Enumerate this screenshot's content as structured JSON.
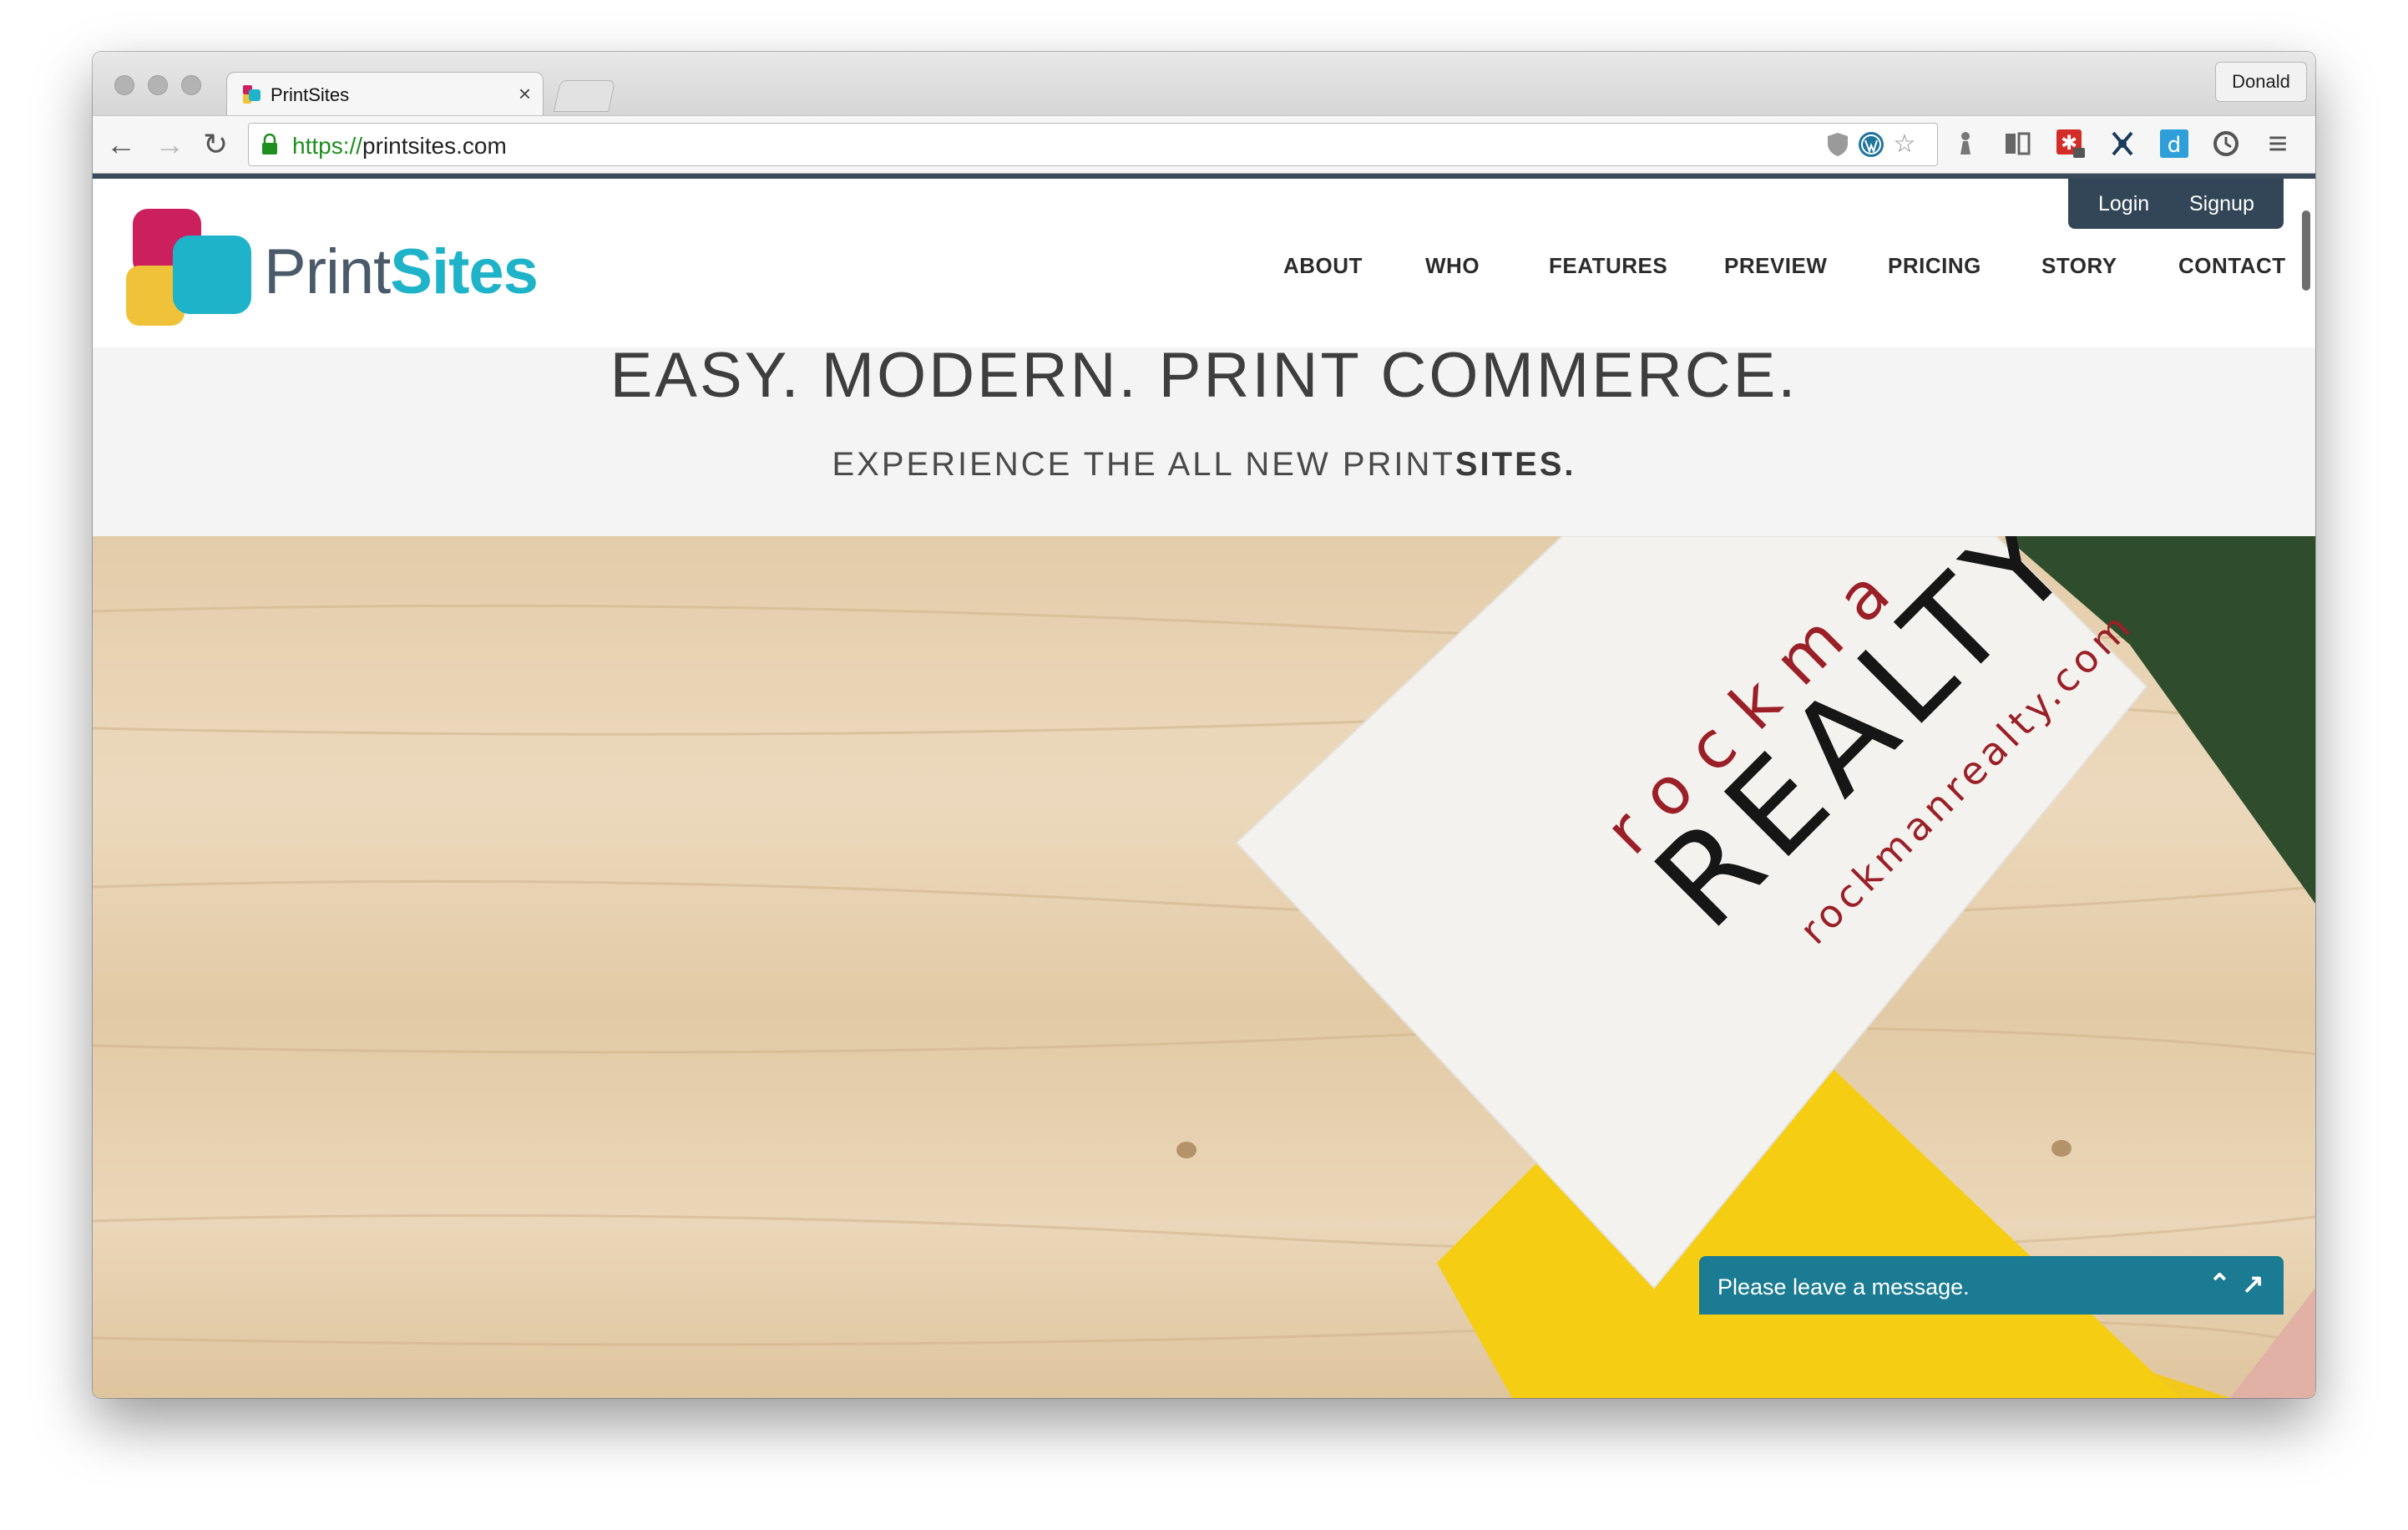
{
  "browser": {
    "tab_title": "PrintSites",
    "tab_close": "×",
    "profile_name": "Donald",
    "url_scheme": "https://",
    "url_host": "printsites.com",
    "back_icon": "←",
    "forward_icon": "→",
    "reload_icon": "↻",
    "bookmark_star": "☆",
    "menu_icon": "≡"
  },
  "site": {
    "logo_part1": "Print",
    "logo_part2": "Sites",
    "login": "Login",
    "signup": "Signup",
    "nav": [
      "ABOUT",
      "WHO",
      "FEATURES",
      "PREVIEW",
      "PRICING",
      "STORY",
      "CONTACT"
    ],
    "hero_title": "EASY. MODERN. PRINT COMMERCE.",
    "hero_sub_prefix": "EXPERIENCE THE ALL NEW PRINT",
    "hero_sub_bold": "SITES.",
    "card_brand_top": "rockma",
    "card_brand_main": "REALTY",
    "card_url": "rockmanrealty.com",
    "chat_text": "Please leave a message."
  },
  "colors": {
    "accent_teal": "#1fb3c9",
    "logo_magenta": "#cc1f5e",
    "logo_yellow": "#f0c23a",
    "auth_bg": "#324657",
    "chat_bg": "#1b7b92"
  }
}
